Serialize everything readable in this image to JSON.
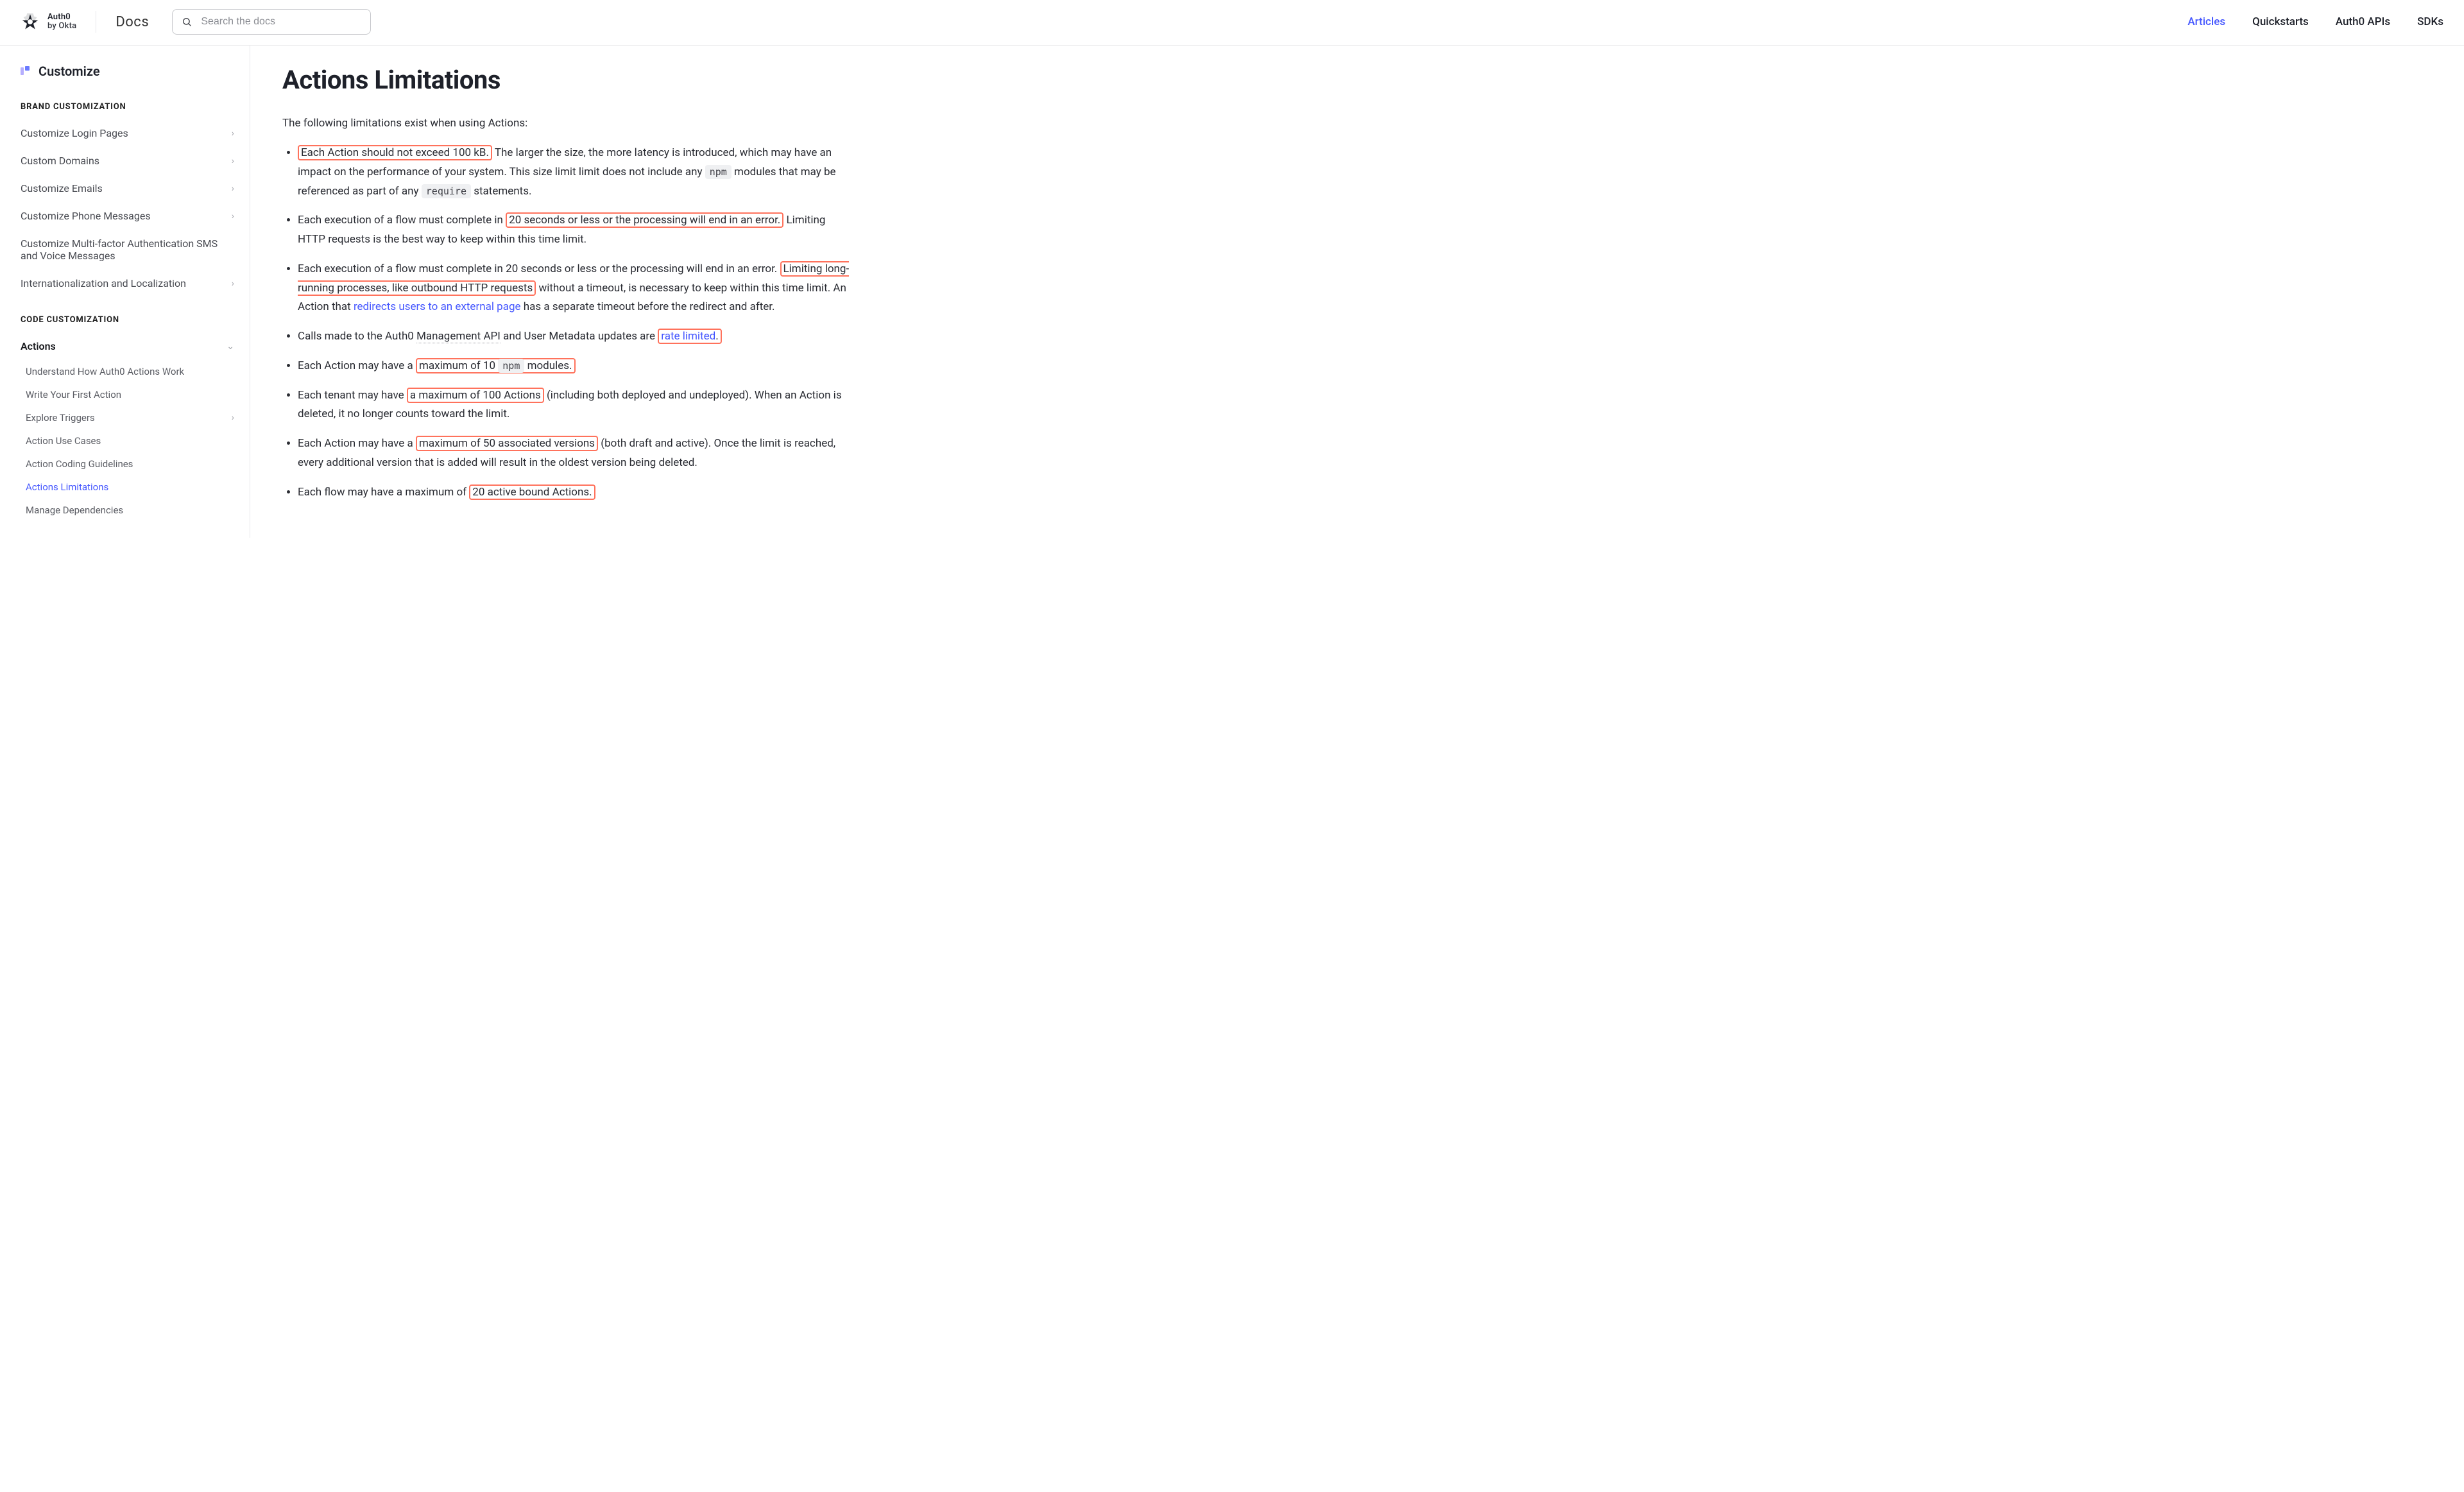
{
  "header": {
    "brand_top": "Auth0",
    "brand_sub": "by Okta",
    "docs_label": "Docs",
    "search_placeholder": "Search the docs",
    "nav": [
      {
        "label": "Articles",
        "active": true
      },
      {
        "label": "Quickstarts",
        "active": false
      },
      {
        "label": "Auth0 APIs",
        "active": false
      },
      {
        "label": "SDKs",
        "active": false
      }
    ]
  },
  "sidebar": {
    "page_title": "Customize",
    "sections": [
      {
        "label": "BRAND CUSTOMIZATION",
        "items": [
          {
            "label": "Customize Login Pages",
            "chevron": true
          },
          {
            "label": "Custom Domains",
            "chevron": true
          },
          {
            "label": "Customize Emails",
            "chevron": true
          },
          {
            "label": "Customize Phone Messages",
            "chevron": true
          },
          {
            "label": "Customize Multi-factor Authentication SMS and Voice Messages",
            "chevron": false
          },
          {
            "label": "Internationalization and Localization",
            "chevron": true
          }
        ]
      },
      {
        "label": "CODE CUSTOMIZATION",
        "items": [
          {
            "label": "Actions",
            "chevron": "down",
            "strong": true,
            "children": [
              {
                "label": "Understand How Auth0 Actions Work"
              },
              {
                "label": "Write Your First Action"
              },
              {
                "label": "Explore Triggers",
                "chevron": true
              },
              {
                "label": "Action Use Cases"
              },
              {
                "label": "Action Coding Guidelines"
              },
              {
                "label": "Actions Limitations",
                "active": true
              },
              {
                "label": "Manage Dependencies"
              }
            ]
          }
        ]
      }
    ]
  },
  "article": {
    "title": "Actions Limitations",
    "intro": "The following limitations exist when using Actions:",
    "code_npm": "npm",
    "code_require": "require",
    "bullets": {
      "b1_hl": "Each Action should not exceed 100 kB.",
      "b1_rest_a": " The larger the size, the more latency is introduced, which may have an impact on the performance of your system. This size limit limit does not include any ",
      "b1_rest_b": " modules that may be referenced as part of any ",
      "b1_rest_c": " statements.",
      "b2_a": "Each execution of a flow must complete in",
      "b2_hl": "20 seconds or less or the processing will end in an error.",
      "b2_b": " Limiting HTTP requests is the best way to keep within this time limit.",
      "b3_a": "Each execution of a flow must complete in 20 seconds or less or the processing will end in an error. ",
      "b3_hl": "Limiting long-running processes, like outbound HTTP requests",
      "b3_b": " without a timeout, is necessary to keep within this time limit. An Action that ",
      "b3_link": "redirects users to an external page",
      "b3_c": " has a separate timeout before the redirect and after.",
      "b4_a": "Calls made to the Auth0 ",
      "b4_dotted": "Management API",
      "b4_b": " and User Metadata updates are ",
      "b4_link": "rate limited",
      "b4_c": ".",
      "b5_a": "Each Action may have a",
      "b5_hl_a": "maximum of 10 ",
      "b5_hl_b": " modules.",
      "b6_a": "Each tenant may have ",
      "b6_hl": "a maximum of 100 Actions",
      "b6_b": " (including both deployed and undeployed). When an Action is deleted, it no longer counts toward the limit.",
      "b7_a": "Each Action may have a ",
      "b7_hl": "maximum of 50 associated versions",
      "b7_b": " (both draft and active). Once the limit is reached, every additional version that is added will result in the oldest version being deleted.",
      "b8_a": "Each flow may have a maximum of ",
      "b8_hl": "20 active bound Actions."
    }
  }
}
